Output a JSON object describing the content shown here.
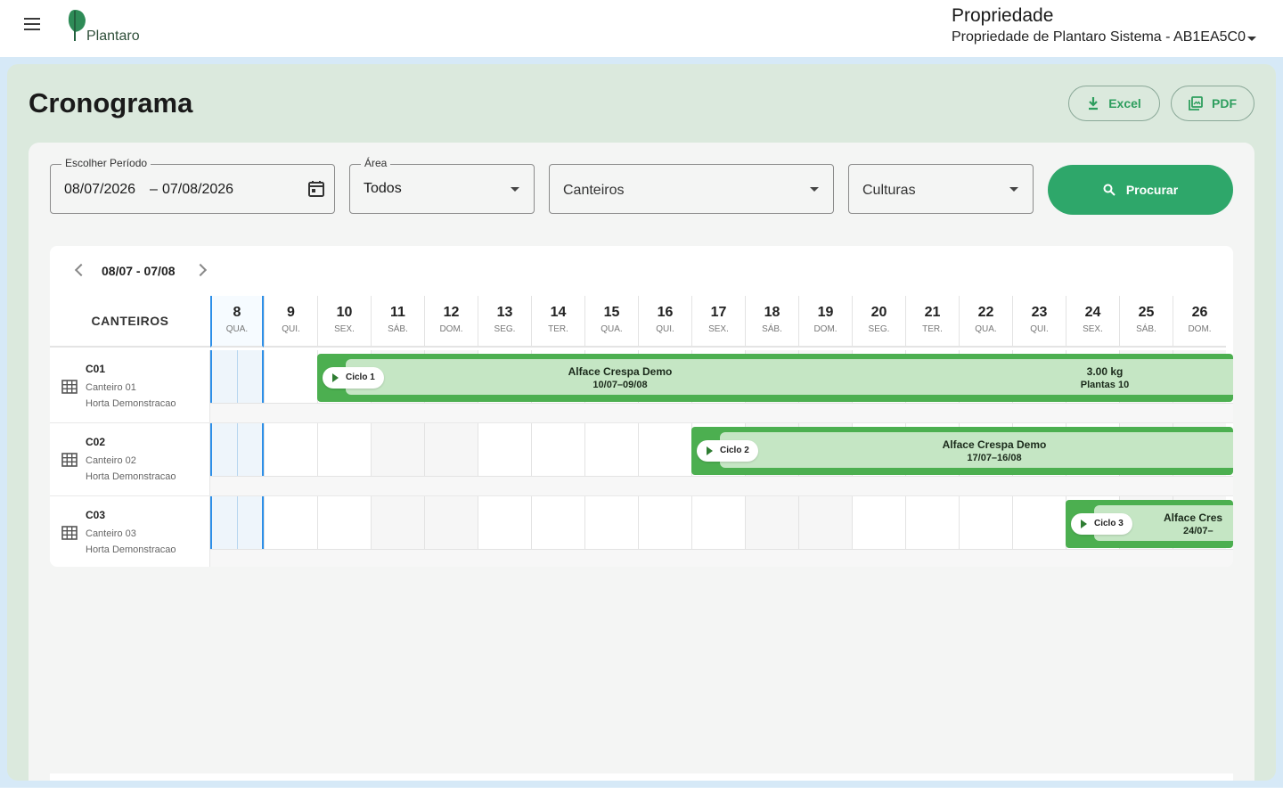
{
  "header": {
    "logo_text": "Plantaro",
    "property_title": "Propriedade",
    "property_value": "Propriedade de Plantaro Sistema - AB1EA5C0"
  },
  "page": {
    "title": "Cronograma",
    "excel_label": "Excel",
    "pdf_label": "PDF"
  },
  "filters": {
    "period_label": "Escolher Período",
    "period_start": "08/07/2026",
    "period_sep": "–",
    "period_end": "07/08/2026",
    "area_label": "Área",
    "area_value": "Todos",
    "canteiros_placeholder": "Canteiros",
    "culturas_placeholder": "Culturas",
    "search_label": "Procurar"
  },
  "schedule": {
    "range_label": "08/07 - 07/08",
    "left_header": "CANTEIROS",
    "days": [
      {
        "n": "8",
        "wd": "QUA."
      },
      {
        "n": "9",
        "wd": "QUI."
      },
      {
        "n": "10",
        "wd": "SEX."
      },
      {
        "n": "11",
        "wd": "SÁB."
      },
      {
        "n": "12",
        "wd": "DOM."
      },
      {
        "n": "13",
        "wd": "SEG."
      },
      {
        "n": "14",
        "wd": "TER."
      },
      {
        "n": "15",
        "wd": "QUA."
      },
      {
        "n": "16",
        "wd": "QUI."
      },
      {
        "n": "17",
        "wd": "SEX."
      },
      {
        "n": "18",
        "wd": "SÁB."
      },
      {
        "n": "19",
        "wd": "DOM."
      },
      {
        "n": "20",
        "wd": "SEG."
      },
      {
        "n": "21",
        "wd": "TER."
      },
      {
        "n": "22",
        "wd": "QUA."
      },
      {
        "n": "23",
        "wd": "QUI."
      },
      {
        "n": "24",
        "wd": "SEX."
      },
      {
        "n": "25",
        "wd": "SÁB."
      },
      {
        "n": "26",
        "wd": "DOM."
      }
    ],
    "rows": [
      {
        "code": "C01",
        "name": "Canteiro 01",
        "area": "Horta Demonstracao",
        "cycle": {
          "chip": "Ciclo 1",
          "crop": "Alface Crespa Demo",
          "dates": "10/07–09/08",
          "start_index": 2,
          "weight": "3.00 kg",
          "plants": "Plantas 10"
        }
      },
      {
        "code": "C02",
        "name": "Canteiro 02",
        "area": "Horta Demonstracao",
        "cycle": {
          "chip": "Ciclo 2",
          "crop": "Alface Crespa Demo",
          "dates": "17/07–16/08",
          "start_index": 9
        }
      },
      {
        "code": "C03",
        "name": "Canteiro 03",
        "area": "Horta Demonstracao",
        "cycle": {
          "chip": "Ciclo 3",
          "crop": "Alface Cres",
          "dates": "24/07–",
          "start_index": 16
        }
      }
    ]
  },
  "colors": {
    "accent": "#2ea76a",
    "bar": "#4caf50",
    "bar_inner": "#c5e6c4",
    "today": "#2d8fe8"
  }
}
